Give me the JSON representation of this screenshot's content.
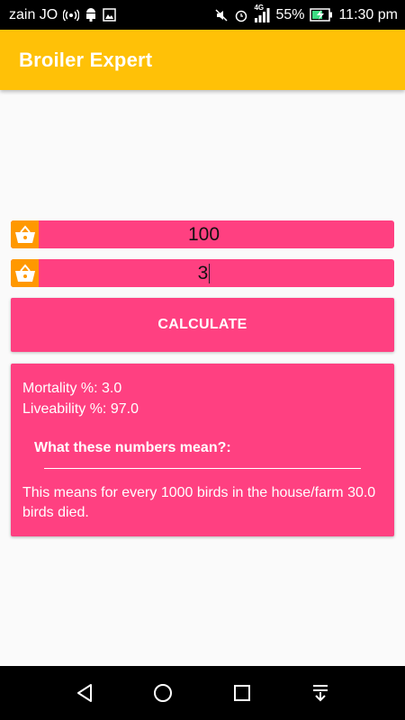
{
  "status_bar": {
    "carrier": "zain JO",
    "network_type": "4G",
    "battery": "55%",
    "time": "11:30 pm"
  },
  "app_bar": {
    "title": "Broiler Expert"
  },
  "inputs": {
    "birds_value": "100",
    "dead_value": "3"
  },
  "calculate_button": {
    "label": "CALCULATE"
  },
  "result": {
    "mortality": "Mortality %: 3.0",
    "liveability": "Liveability %: 97.0",
    "heading": "What these numbers mean?:",
    "description": "This means for every 1000 birds in the house/farm 30.0 birds died."
  },
  "colors": {
    "app_bar": "#FFC107",
    "accent": "#FF4081",
    "icon_bg": "#FF9800"
  },
  "icons": {
    "input_icon": "basket-icon",
    "nav": [
      "back-icon",
      "home-icon",
      "recents-icon",
      "notification-pull-icon"
    ]
  }
}
